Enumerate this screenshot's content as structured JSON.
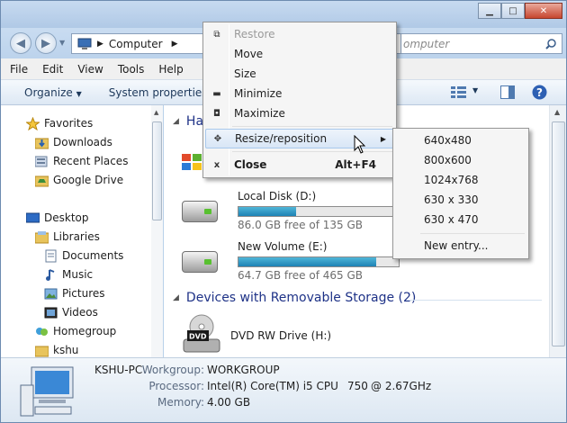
{
  "address": {
    "location": "Computer"
  },
  "search": {
    "placeholder": "omputer"
  },
  "menubar": [
    "File",
    "Edit",
    "View",
    "Tools",
    "Help"
  ],
  "toolbar": {
    "organize": "Organize",
    "system_properties": "System properties"
  },
  "sidebar": {
    "favorites": {
      "label": "Favorites",
      "items": [
        "Downloads",
        "Recent Places",
        "Google Drive"
      ]
    },
    "desktop": "Desktop",
    "libraries": {
      "label": "Libraries",
      "items": [
        "Documents",
        "Music",
        "Pictures",
        "Videos"
      ]
    },
    "homegroup": "Homegroup",
    "user": "kshu"
  },
  "main": {
    "group_hard_disks_partial": "Ha",
    "drives": [
      {
        "name": "Local Disk (D:)",
        "free_text": "86.0 GB free of 135 GB",
        "used_fraction": 0.36
      },
      {
        "name": "New Volume (E:)",
        "free_text": "64.7 GB free of 465 GB",
        "used_fraction": 0.86
      }
    ],
    "group_removable": "Devices with Removable Storage (2)",
    "dvd": {
      "name": "DVD RW Drive (H:)",
      "badge": "DVD"
    }
  },
  "details": {
    "pc_name": "KSHU-PC",
    "workgroup_label": "Workgroup:",
    "workgroup_value": "WORKGROUP",
    "processor_label": "Processor:",
    "processor_value": "Intel(R) Core(TM) i5 CPU",
    "processor_model": "750",
    "processor_speed": "@ 2.67GHz",
    "memory_label": "Memory:",
    "memory_value": "4.00 GB"
  },
  "context_menu": {
    "restore": "Restore",
    "move": "Move",
    "size": "Size",
    "minimize": "Minimize",
    "maximize": "Maximize",
    "resize": "Resize/reposition",
    "close": "Close",
    "close_shortcut": "Alt+F4"
  },
  "submenu": [
    "640x480",
    "800x600",
    "1024x768",
    "630 x 330",
    "630 x 470",
    "New entry..."
  ]
}
